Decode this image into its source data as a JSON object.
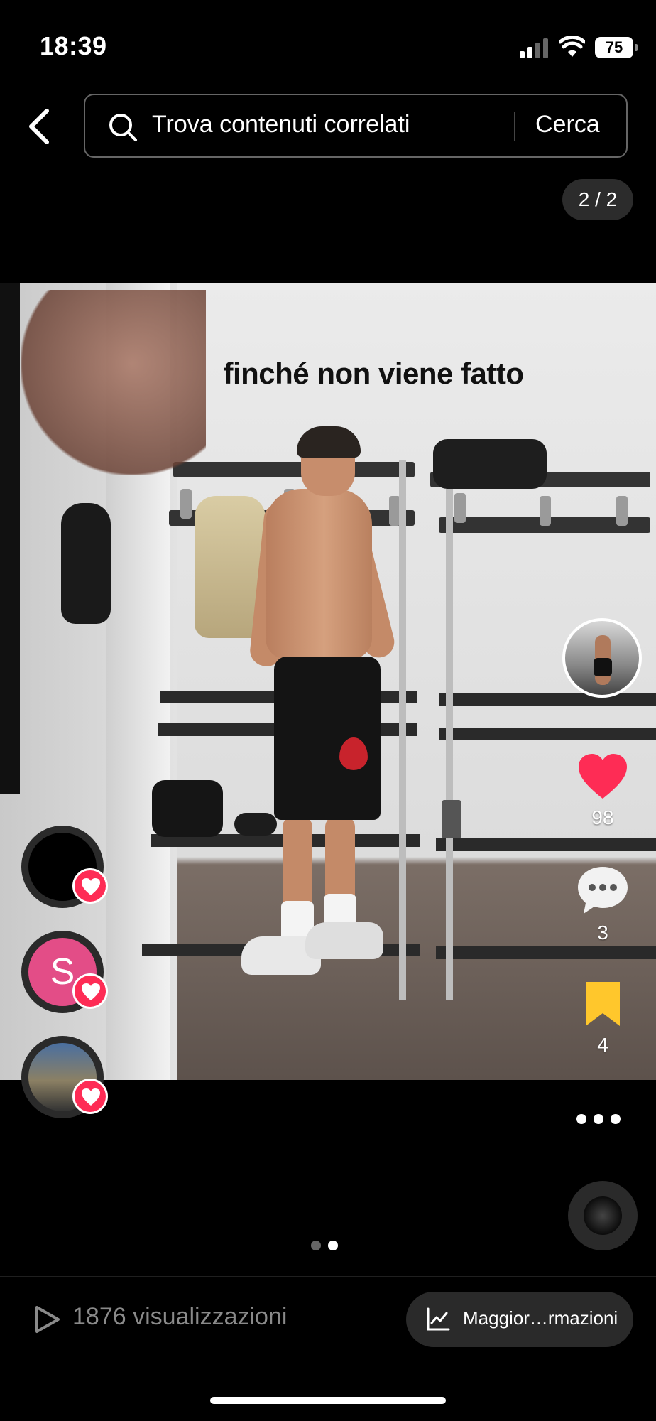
{
  "status_bar": {
    "time": "18:39",
    "battery": "75",
    "icons": [
      "signal-icon",
      "wifi-icon",
      "battery-icon"
    ]
  },
  "search": {
    "placeholder": "Trova contenuti correlati",
    "submit_label": "Cerca",
    "icons": [
      "back-arrow-icon",
      "search-icon"
    ]
  },
  "page_counter": "2 / 2",
  "media": {
    "caption": "finché non viene fatto"
  },
  "actions": {
    "likes": "98",
    "comments": "3",
    "saves": "4",
    "icons": [
      "heart-icon",
      "comment-icon",
      "bookmark-icon",
      "more-icon"
    ],
    "colors": {
      "like": "#fe2c55",
      "bookmark": "#ffc72c"
    }
  },
  "reactors": [
    {
      "initial": ""
    },
    {
      "initial": "S"
    },
    {
      "initial": ""
    }
  ],
  "carousel": {
    "current": 2,
    "total": 2
  },
  "footer": {
    "views_label": "1876 visualizzazioni",
    "insights_label": "Maggior…rmazioni",
    "icons": [
      "play-icon",
      "analytics-icon"
    ]
  }
}
